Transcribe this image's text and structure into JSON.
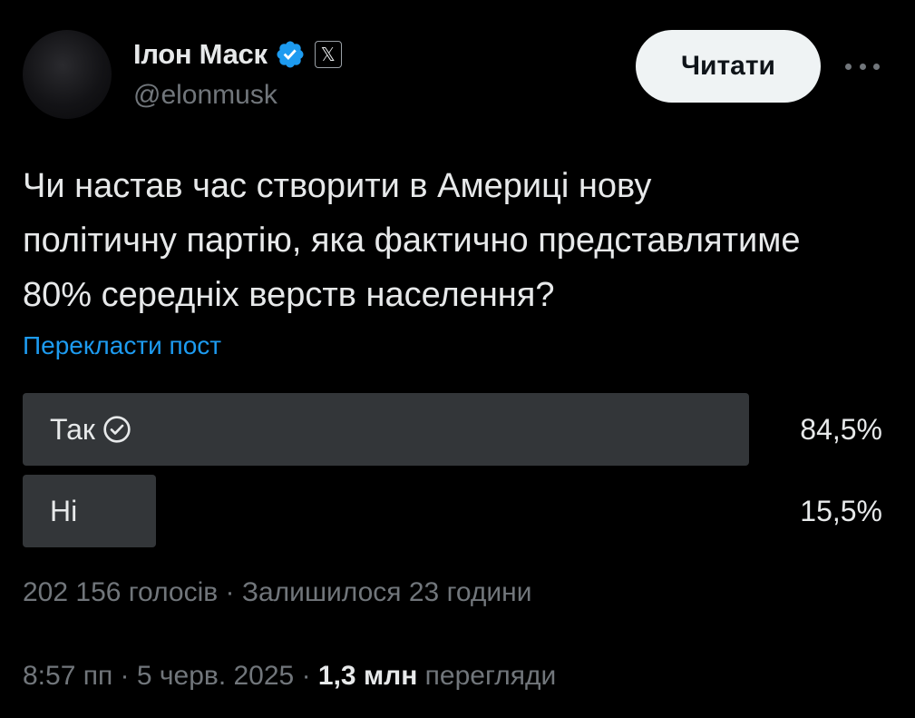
{
  "author": {
    "name": "Ілон Маск",
    "handle": "@elonmusk",
    "verified_color": "#1d9bf0",
    "affiliation_icon": "x-logo-icon"
  },
  "follow_label": "Читати",
  "more_icon": "more-icon",
  "post": {
    "line1": "Чи настав час створити в Америці нову",
    "line2": "політичну партію, яка фактично представлятиме",
    "line3": "80% середніх верств населення?"
  },
  "translate_label": "Перекласти пост",
  "poll": {
    "options": [
      {
        "label": "Так",
        "percent": "84,5%",
        "fraction": 0.845,
        "winner": true
      },
      {
        "label": "Ні",
        "percent": "15,5%",
        "fraction": 0.155,
        "winner": false
      }
    ],
    "summary": "202 156 голосів · Залишилося 23 години"
  },
  "footer": {
    "time": "8:57 пп · 5 черв. 2025 · ",
    "views_count": "1,3 млн",
    "views_label": " перегляди"
  }
}
